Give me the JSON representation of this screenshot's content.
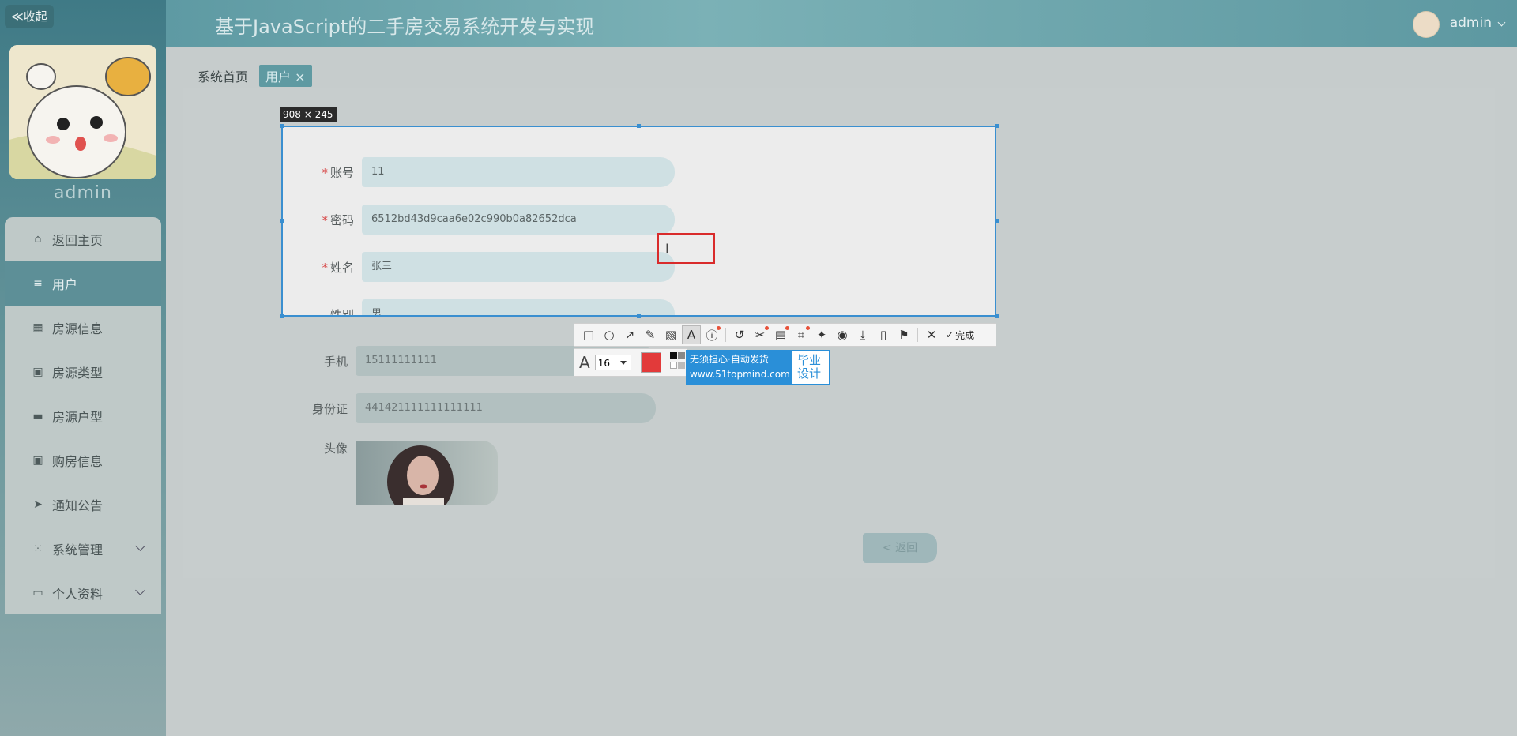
{
  "sidebar": {
    "collapse_label": "≪收起",
    "username": "admin",
    "items": [
      {
        "label": "返回主页",
        "icon": "home-icon"
      },
      {
        "label": "用户",
        "icon": "list-icon"
      },
      {
        "label": "房源信息",
        "icon": "grid-icon"
      },
      {
        "label": "房源类型",
        "icon": "clipboard-icon"
      },
      {
        "label": "房源户型",
        "icon": "monitor-icon"
      },
      {
        "label": "购房信息",
        "icon": "clipboard-check-icon"
      },
      {
        "label": "通知公告",
        "icon": "send-icon"
      },
      {
        "label": "系统管理",
        "icon": "apps-icon"
      },
      {
        "label": "个人资料",
        "icon": "card-icon"
      }
    ]
  },
  "header": {
    "title": "基于JavaScript的二手房交易系统开发与实现",
    "user": "admin"
  },
  "breadcrumb": {
    "home": "系统首页",
    "tag": "用户 ×"
  },
  "form": {
    "account_label": "账号",
    "account_value": "11",
    "password_label": "密码",
    "password_value": "6512bd43d9caa6e02c990b0a82652dca",
    "name_label": "姓名",
    "name_value": "张三",
    "gender_label": "性别",
    "gender_value": "男",
    "phone_label": "手机",
    "phone_value": "15111111111",
    "idcard_label": "身份证",
    "idcard_value": "441421111111111111",
    "avatar_label": "头像",
    "back_label": "< 返回"
  },
  "capture_tool": {
    "size_label": "908 × 245",
    "done_label": "完成",
    "font_size": "16",
    "promo_line1": "无须担心·自动发货",
    "promo_line2": "www.51topmind.com",
    "promo_right": "毕业设计"
  },
  "colors": {
    "accent": "#5d8f97",
    "selection_border": "#3a8fd0",
    "text_box": "#d92b2b",
    "brush_color": "#e23a3a"
  }
}
